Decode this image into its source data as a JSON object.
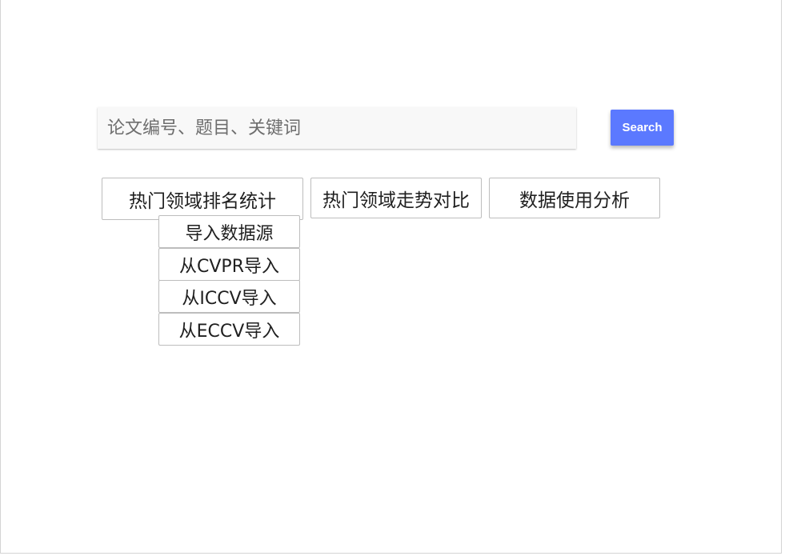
{
  "search": {
    "placeholder": "论文编号、题目、关键词",
    "value": "",
    "button_label": "Search"
  },
  "nav": {
    "hot_rank_label": "热门领域排名统计",
    "hot_trend_label": "热门领域走势对比",
    "data_usage_label": "数据使用分析"
  },
  "dropdown": {
    "items": [
      {
        "label": "导入数据源"
      },
      {
        "label": "从CVPR导入"
      },
      {
        "label": "从ICCV导入"
      },
      {
        "label": "从ECCV导入"
      }
    ]
  },
  "colors": {
    "accent": "#5b79ff",
    "input_bg": "#f8f8f8",
    "border": "#bdbdbd"
  }
}
